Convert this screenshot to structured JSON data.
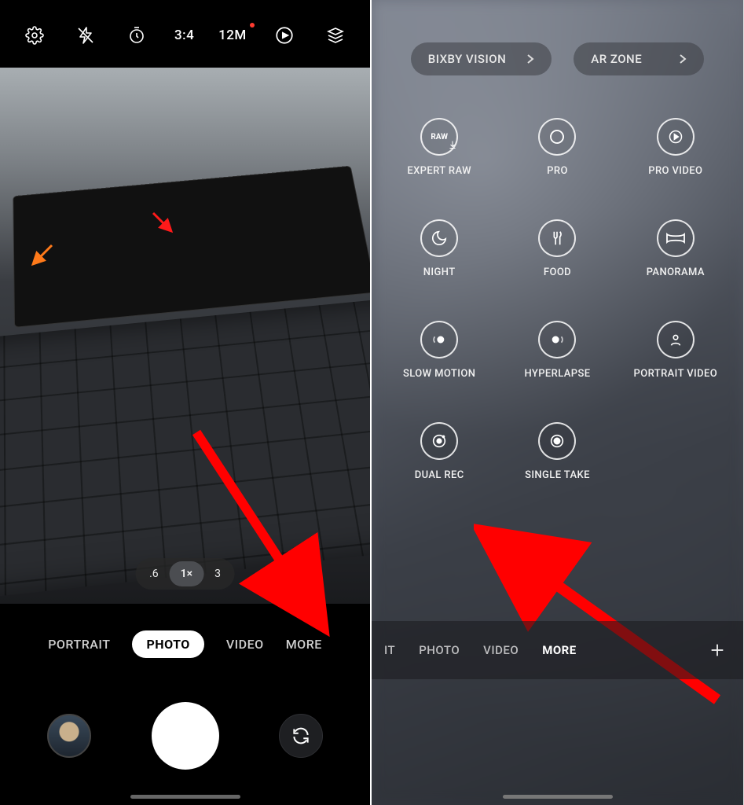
{
  "left": {
    "toolbar": {
      "ratio": "3:4",
      "resolution": "12M"
    },
    "zoom": {
      "opt1": ".6",
      "opt2": "1×",
      "opt3": "3"
    },
    "modes": {
      "portrait": "PORTRAIT",
      "photo": "PHOTO",
      "video": "VIDEO",
      "more": "MORE"
    }
  },
  "right": {
    "pills": {
      "bixby": "BIXBY VISION",
      "arzone": "AR ZONE"
    },
    "grid": {
      "expert_raw": "EXPERT RAW",
      "pro": "PRO",
      "pro_video": "PRO VIDEO",
      "night": "NIGHT",
      "food": "FOOD",
      "panorama": "PANORAMA",
      "slow_motion": "SLOW MOTION",
      "hyperlapse": "HYPERLAPSE",
      "portrait_video": "PORTRAIT VIDEO",
      "dual_rec": "DUAL REC",
      "single_take": "SINGLE TAKE"
    },
    "modes": {
      "it": "IT",
      "photo": "PHOTO",
      "video": "VIDEO",
      "more": "MORE"
    }
  }
}
